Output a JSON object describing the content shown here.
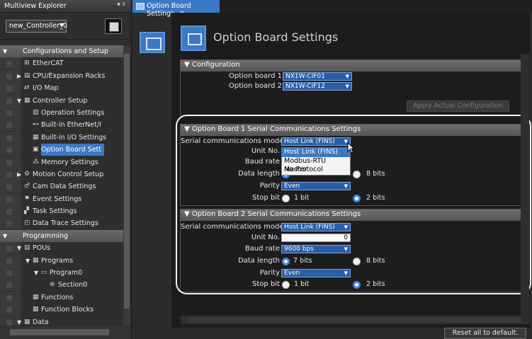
{
  "explorer": {
    "title": "Multiview Explorer",
    "controls": "▾ ♯",
    "controller_name": "new_Controller_0",
    "tree": [
      {
        "label": "Configurations and Setup",
        "level": 0,
        "type": "section",
        "arrow": "▼"
      },
      {
        "label": "EtherCAT",
        "level": 1,
        "icon": "⊞"
      },
      {
        "label": "CPU/Expansion Racks",
        "level": 1,
        "arrow": "▶",
        "icon": "▤"
      },
      {
        "label": "I/O Map",
        "level": 1,
        "icon": "⇄"
      },
      {
        "label": "Controller Setup",
        "level": 1,
        "arrow": "▼",
        "icon": "▦"
      },
      {
        "label": "Operation Settings",
        "level": 2,
        "icon": "▥"
      },
      {
        "label": "Built-in EtherNet/I",
        "level": 2,
        "icon": "⊷"
      },
      {
        "label": "Built-in I/O Settings",
        "level": 2,
        "icon": "▦"
      },
      {
        "label": "Option Board Sett",
        "level": 2,
        "icon": "▣",
        "selected": true
      },
      {
        "label": "Memory Settings",
        "level": 2,
        "icon": "⁂"
      },
      {
        "label": "Motion Control Setup",
        "level": 1,
        "arrow": "▶",
        "icon": "⚙"
      },
      {
        "label": "Cam Data Settings",
        "level": 1,
        "icon": "♂"
      },
      {
        "label": "Event Settings",
        "level": 1,
        "icon": "⚑"
      },
      {
        "label": "Task Settings",
        "level": 1,
        "icon": "▞"
      },
      {
        "label": "Data Trace Settings",
        "level": 1,
        "icon": "◰"
      },
      {
        "label": "Programming",
        "level": 0,
        "type": "section",
        "arrow": "▼"
      },
      {
        "label": "POUs",
        "level": 1,
        "arrow": "▼",
        "icon": "▤"
      },
      {
        "label": "Programs",
        "level": 2,
        "arrow": "▼",
        "icon": "▦"
      },
      {
        "label": "Program0",
        "level": 3,
        "arrow": "▼",
        "icon": "▭"
      },
      {
        "label": "Section0",
        "level": 4,
        "icon": "⊕"
      },
      {
        "label": "Functions",
        "level": 2,
        "icon": "▦"
      },
      {
        "label": "Function Blocks",
        "level": 2,
        "icon": "▦"
      },
      {
        "label": "Data",
        "level": 1,
        "arrow": "▼",
        "icon": "▦"
      }
    ]
  },
  "editor": {
    "tab_label": "Option Board Settings",
    "tab_close": "✕",
    "page_title": "Option Board Settings",
    "configuration": {
      "header": "▼ Configuration",
      "option_board_1_label": "Option board 1",
      "option_board_1_value": "NX1W-CIF01",
      "option_board_2_label": "Option board 2",
      "option_board_2_value": "NX1W-CIF12",
      "apply_button": "Apply Actual Configuration"
    },
    "board1": {
      "header": "▼ Option Board 1 Serial Communications Settings",
      "mode_label": "Serial communications mode",
      "mode_value": "Host Link (FINS)",
      "unit_label": "Unit No.",
      "baud_label": "Baud rate",
      "data_length_label": "Data length",
      "data_length_opt1": "7 bits",
      "data_length_opt2": "8 bits",
      "parity_label": "Parity",
      "parity_value": "Even",
      "stop_bit_label": "Stop bit",
      "stop_bit_opt1": "1 bit",
      "stop_bit_opt2": "2 bits"
    },
    "mode_dropdown_options": [
      "Host Link (FINS)",
      "Modbus-RTU Master",
      "No-Protocol"
    ],
    "board2": {
      "header": "▼ Option Board 2 Serial Communications Settings",
      "mode_label": "Serial communications mode",
      "mode_value": "Host Link (FINS)",
      "unit_label": "Unit No.",
      "unit_value": "0",
      "baud_label": "Baud rate",
      "baud_value": "9600 bps",
      "data_length_label": "Data length",
      "data_length_opt1": "7 bits",
      "data_length_opt2": "8 bits",
      "parity_label": "Parity",
      "parity_value": "Even",
      "stop_bit_label": "Stop bit",
      "stop_bit_opt1": "1 bit",
      "stop_bit_opt2": "2 bits"
    },
    "reset_button": "Reset all to default."
  },
  "colors": {
    "selection_blue": "#3d78c4",
    "dropdown_blue": "#2a5ea8",
    "radio_blue": "#3d8ae6"
  }
}
